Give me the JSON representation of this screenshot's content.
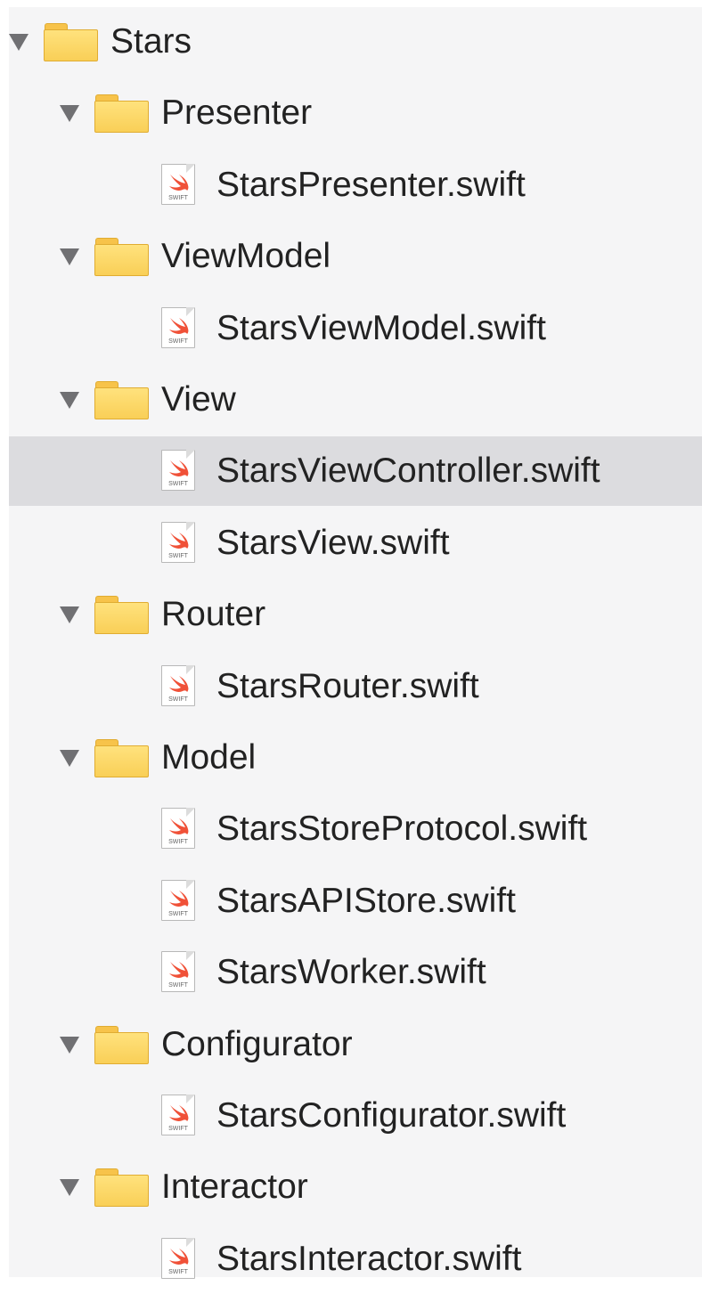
{
  "navigator": {
    "tree": [
      {
        "kind": "folder",
        "label": "Stars",
        "expanded": true,
        "level": 0
      },
      {
        "kind": "folder",
        "label": "Presenter",
        "expanded": true,
        "level": 1
      },
      {
        "kind": "file",
        "label": "StarsPresenter.swift",
        "icon": "swift-file-icon",
        "level": 2
      },
      {
        "kind": "folder",
        "label": "ViewModel",
        "expanded": true,
        "level": 1
      },
      {
        "kind": "file",
        "label": "StarsViewModel.swift",
        "icon": "swift-file-icon",
        "level": 2
      },
      {
        "kind": "folder",
        "label": "View",
        "expanded": true,
        "level": 1
      },
      {
        "kind": "file",
        "label": "StarsViewController.swift",
        "icon": "swift-file-icon",
        "level": 2,
        "selected": true
      },
      {
        "kind": "file",
        "label": "StarsView.swift",
        "icon": "swift-file-icon",
        "level": 2
      },
      {
        "kind": "folder",
        "label": "Router",
        "expanded": true,
        "level": 1
      },
      {
        "kind": "file",
        "label": "StarsRouter.swift",
        "icon": "swift-file-icon",
        "level": 2
      },
      {
        "kind": "folder",
        "label": "Model",
        "expanded": true,
        "level": 1
      },
      {
        "kind": "file",
        "label": "StarsStoreProtocol.swift",
        "icon": "swift-file-icon",
        "level": 2
      },
      {
        "kind": "file",
        "label": "StarsAPIStore.swift",
        "icon": "swift-file-icon",
        "level": 2
      },
      {
        "kind": "file",
        "label": "StarsWorker.swift",
        "icon": "swift-file-icon",
        "level": 2
      },
      {
        "kind": "folder",
        "label": "Configurator",
        "expanded": true,
        "level": 1
      },
      {
        "kind": "file",
        "label": "StarsConfigurator.swift",
        "icon": "swift-file-icon",
        "level": 2
      },
      {
        "kind": "folder",
        "label": "Interactor",
        "expanded": true,
        "level": 1
      },
      {
        "kind": "file",
        "label": "StarsInteractor.swift",
        "icon": "swift-file-icon",
        "level": 2
      }
    ],
    "file_badge_text": "SWIFT",
    "colors": {
      "background": "#f5f5f6",
      "selection": "#dcdcdf",
      "folder": "#f9cf57",
      "swift": "#f05138",
      "text": "#222222"
    }
  }
}
